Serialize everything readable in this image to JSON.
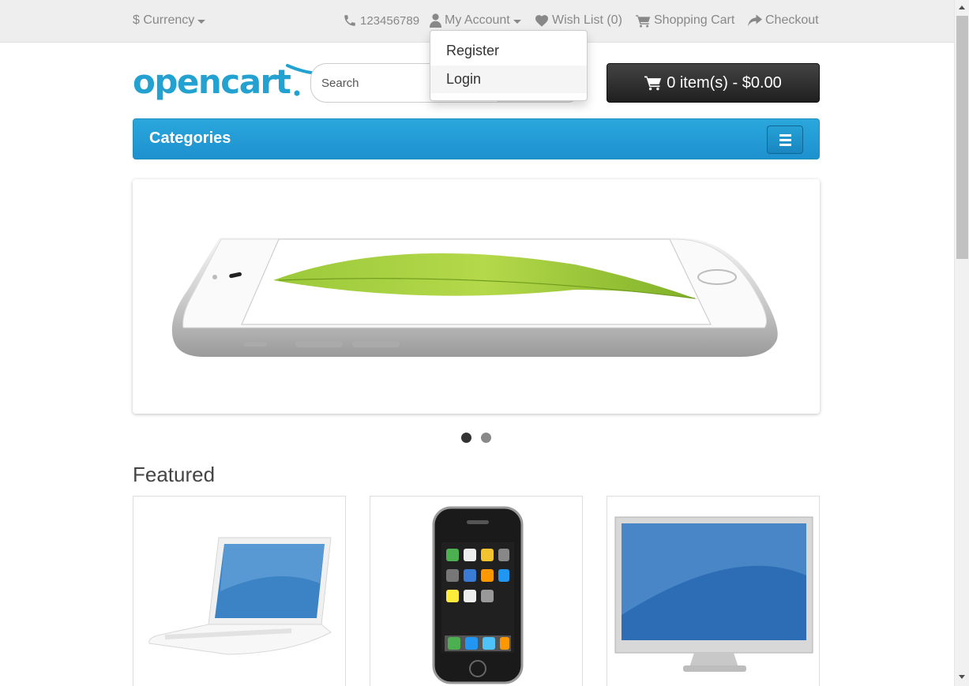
{
  "top_bar": {
    "currency_label": "$ Currency",
    "phone": "123456789",
    "my_account": "My Account",
    "wish_list": "Wish List (0)",
    "shopping_cart": "Shopping Cart",
    "checkout": "Checkout"
  },
  "account_dropdown": {
    "items": [
      {
        "label": "Register"
      },
      {
        "label": "Login"
      }
    ]
  },
  "header": {
    "logo_text": "opencart",
    "search_placeholder": "Search",
    "cart_summary": "0 item(s) - $0.00"
  },
  "menu": {
    "title": "Categories"
  },
  "slideshow": {
    "slide_count": 2,
    "active_slide": 1,
    "image": "iphone-6-leaf-banner"
  },
  "featured": {
    "heading": "Featured",
    "products": [
      {
        "image": "macbook-white-laptop"
      },
      {
        "image": "iphone-original"
      },
      {
        "image": "apple-cinema-display"
      }
    ]
  },
  "colors": {
    "brand_blue": "#23a1d1",
    "menu_blue": "#229ac8",
    "cart_dark": "#363636",
    "text_gray": "#888888"
  }
}
